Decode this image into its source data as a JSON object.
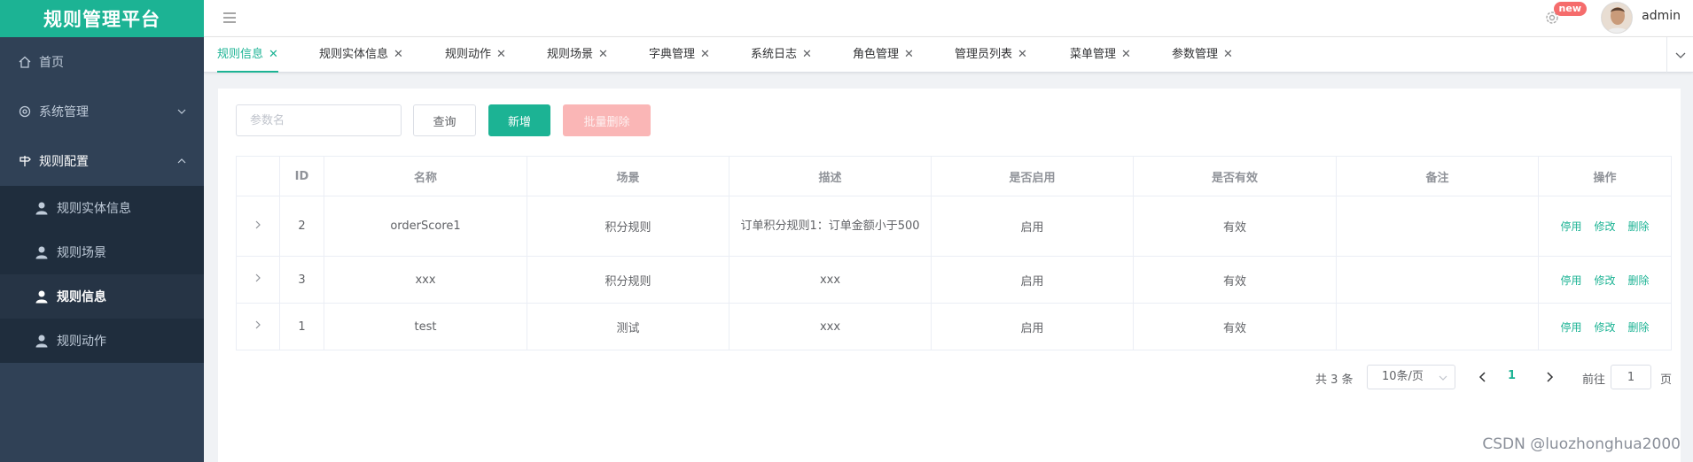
{
  "app": {
    "title": "规则管理平台"
  },
  "sidebar": {
    "items": [
      {
        "label": "首页",
        "icon": "home-icon"
      },
      {
        "label": "系统管理",
        "icon": "gear-icon"
      },
      {
        "label": "规则配置",
        "icon": "signpost-icon"
      }
    ],
    "sub_items": [
      {
        "label": "规则实体信息",
        "icon": "user-icon"
      },
      {
        "label": "规则场景",
        "icon": "user-icon"
      },
      {
        "label": "规则信息",
        "icon": "user-icon",
        "active": true
      },
      {
        "label": "规则动作",
        "icon": "user-icon"
      }
    ]
  },
  "header": {
    "badge": "new",
    "username": "admin"
  },
  "tabs": [
    {
      "label": "规则信息",
      "active": true
    },
    {
      "label": "规则实体信息"
    },
    {
      "label": "规则动作"
    },
    {
      "label": "规则场景"
    },
    {
      "label": "字典管理"
    },
    {
      "label": "系统日志"
    },
    {
      "label": "角色管理"
    },
    {
      "label": "管理员列表"
    },
    {
      "label": "菜单管理"
    },
    {
      "label": "参数管理"
    }
  ],
  "toolbar": {
    "search_placeholder": "参数名",
    "query_label": "查询",
    "add_label": "新增",
    "batch_delete_label": "批量删除"
  },
  "table": {
    "headers": [
      "",
      "ID",
      "名称",
      "场景",
      "描述",
      "是否启用",
      "是否有效",
      "备注",
      "操作"
    ],
    "rows": [
      {
        "id": "2",
        "name": "orderScore1",
        "scene": "积分规则",
        "desc": "订单积分规则1：订单金额小于500",
        "enabled": "启用",
        "valid": "有效",
        "remark": ""
      },
      {
        "id": "3",
        "name": "xxx",
        "scene": "积分规则",
        "desc": "xxx",
        "enabled": "启用",
        "valid": "有效",
        "remark": ""
      },
      {
        "id": "1",
        "name": "test",
        "scene": "测试",
        "desc": "xxx",
        "enabled": "启用",
        "valid": "有效",
        "remark": ""
      }
    ],
    "actions": {
      "disable": "停用",
      "edit": "修改",
      "delete": "删除"
    }
  },
  "pagination": {
    "total": "共 3 条",
    "page_size": "10条/页",
    "current_page": "1",
    "goto_label": "前往",
    "goto_value": "1",
    "page_suffix": "页"
  },
  "watermark": "CSDN @luozhonghua2000",
  "colors": {
    "accent": "#1cb394",
    "sidebar_bg": "#304156",
    "danger_light": "#fab6b6",
    "badge": "#f56c6c"
  }
}
